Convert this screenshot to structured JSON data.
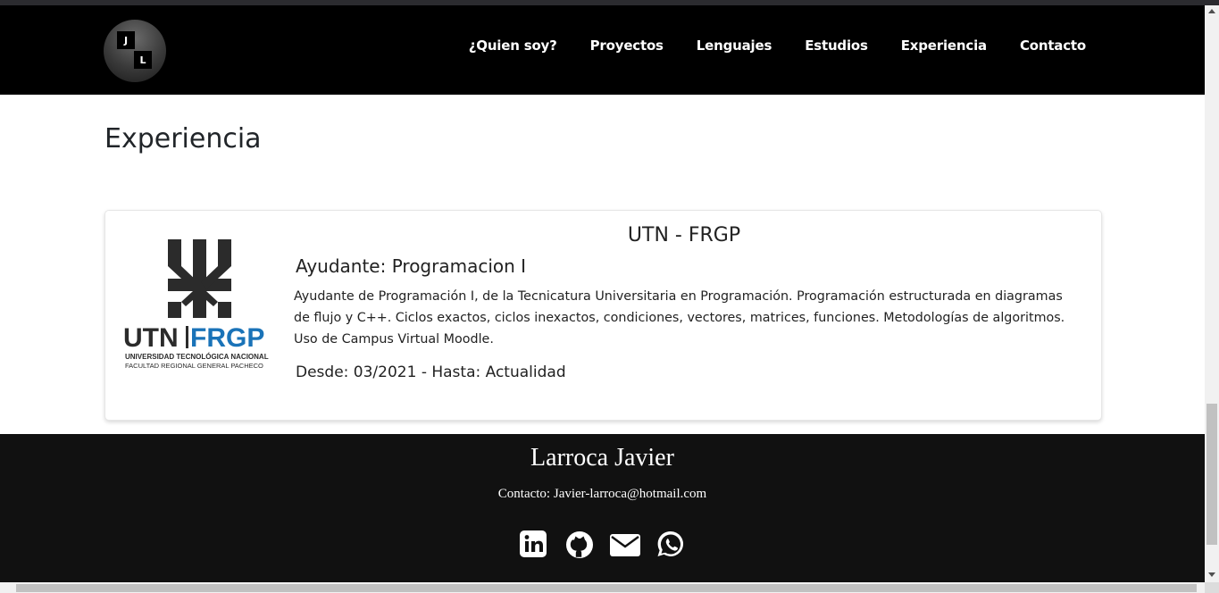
{
  "header": {
    "logo": {
      "letter_1": "J",
      "letter_2": "L"
    },
    "nav": [
      {
        "label": "¿Quien soy?"
      },
      {
        "label": "Proyectos"
      },
      {
        "label": "Lenguajes"
      },
      {
        "label": "Estudios"
      },
      {
        "label": "Experiencia"
      },
      {
        "label": "Contacto"
      }
    ]
  },
  "experience": {
    "title": "Experiencia",
    "card": {
      "logo": {
        "wordmark_left": "UTN",
        "wordmark_right": "FRGP",
        "subtitle_1": "UNIVERSIDAD TECNOLÓGICA NACIONAL",
        "subtitle_2": "FACULTAD REGIONAL GENERAL PACHECO",
        "accent_color": "#1a73b8"
      },
      "organization": "UTN - FRGP",
      "role": "Ayudante: Programacion I",
      "description": "Ayudante de Programación I, de la Tecnicatura Universitaria en Programación. Programación estructurada en diagramas de flujo y C++. Ciclos exactos, ciclos inexactos, condiciones, vectores, matrices, funciones. Metodologías de algoritmos. Uso de Campus Virtual Moodle.",
      "dates": "Desde: 03/2021 - Hasta: Actualidad"
    }
  },
  "footer": {
    "name": "Larroca Javier",
    "contact": "Contacto: Javier-larroca@hotmail.com",
    "socials": [
      {
        "icon": "linkedin-icon"
      },
      {
        "icon": "github-icon"
      },
      {
        "icon": "envelope-icon"
      },
      {
        "icon": "whatsapp-icon"
      }
    ]
  }
}
